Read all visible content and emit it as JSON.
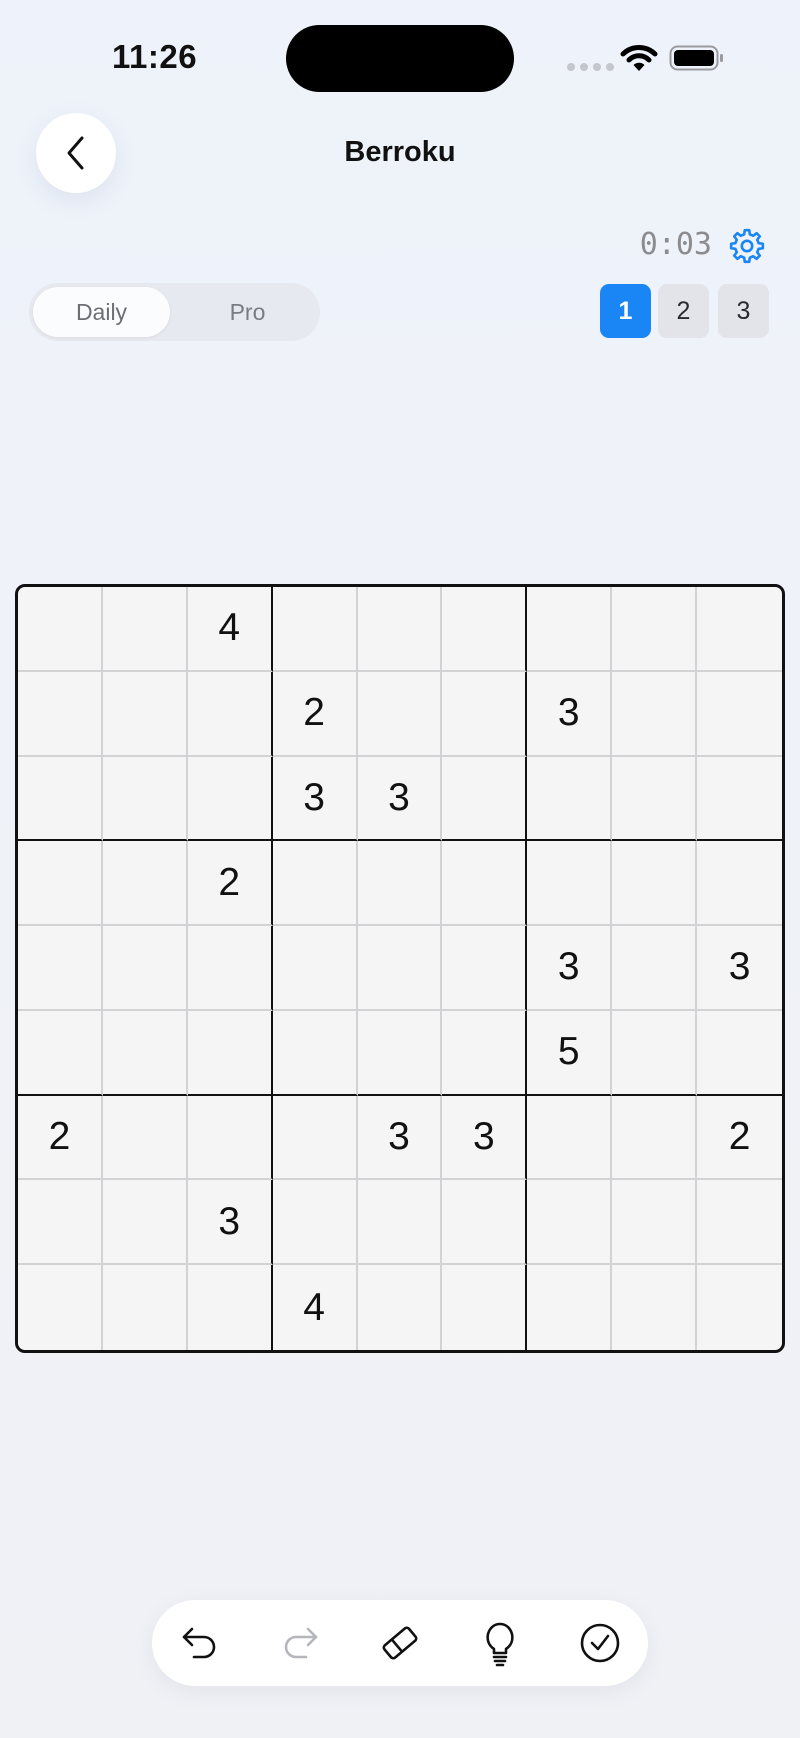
{
  "status_bar": {
    "time": "11:26"
  },
  "header": {
    "title": "Berroku",
    "back_icon": "chevron-left-icon"
  },
  "game": {
    "timer": "0:03",
    "settings_icon": "gear-icon",
    "mode_tabs": [
      {
        "label": "Daily",
        "selected": true
      },
      {
        "label": "Pro",
        "selected": false
      }
    ],
    "levels": [
      {
        "label": "1",
        "selected": true
      },
      {
        "label": "2",
        "selected": false
      },
      {
        "label": "3",
        "selected": false
      }
    ],
    "grid": [
      [
        "",
        "",
        "4",
        "",
        "",
        "",
        "",
        "",
        ""
      ],
      [
        "",
        "",
        "",
        "2",
        "",
        "",
        "3",
        "",
        ""
      ],
      [
        "",
        "",
        "",
        "3",
        "3",
        "",
        "",
        "",
        ""
      ],
      [
        "",
        "",
        "2",
        "",
        "",
        "",
        "",
        "",
        ""
      ],
      [
        "",
        "",
        "",
        "",
        "",
        "",
        "3",
        "",
        "3"
      ],
      [
        "",
        "",
        "",
        "",
        "",
        "",
        "5",
        "",
        ""
      ],
      [
        "2",
        "",
        "",
        "",
        "3",
        "3",
        "",
        "",
        "2"
      ],
      [
        "",
        "",
        "3",
        "",
        "",
        "",
        "",
        "",
        ""
      ],
      [
        "",
        "",
        "",
        "4",
        "",
        "",
        "",
        "",
        ""
      ]
    ]
  },
  "toolbar": {
    "tools": [
      {
        "icon": "undo-icon",
        "enabled": true
      },
      {
        "icon": "redo-icon",
        "enabled": false
      },
      {
        "icon": "eraser-icon",
        "enabled": true
      },
      {
        "icon": "lightbulb-icon",
        "enabled": true
      },
      {
        "icon": "check-circle-icon",
        "enabled": true
      }
    ]
  },
  "colors": {
    "accent": "#1a85f5",
    "background": "#f0f1f5",
    "cell": "#f5f5f5"
  }
}
